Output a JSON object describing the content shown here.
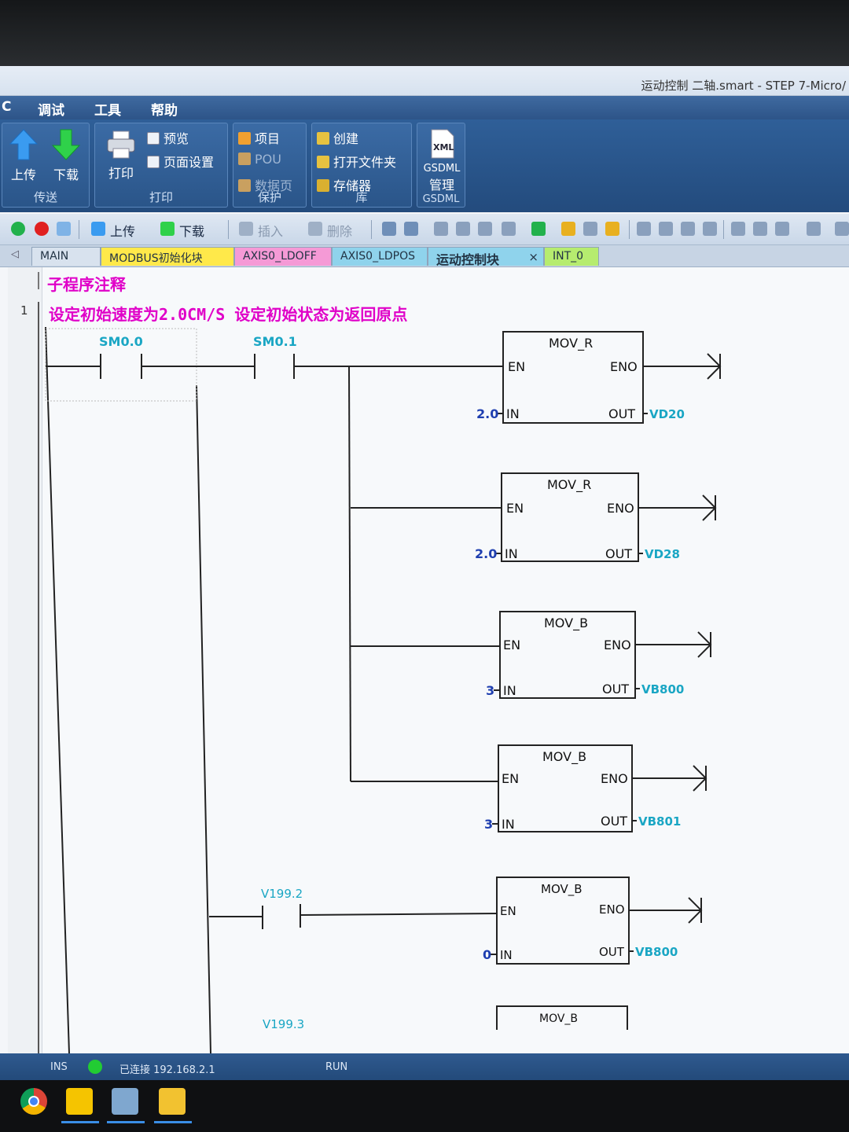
{
  "window": {
    "title": "运动控制 二轴.smart - STEP 7-Micro/"
  },
  "menu": {
    "items": [
      "C",
      "调试",
      "工具",
      "帮助"
    ]
  },
  "ribbon": {
    "transfer": {
      "upload": "上传",
      "download": "下载",
      "group": "传送"
    },
    "print": {
      "print": "打印",
      "preview": "预览",
      "page_setup": "页面设置",
      "group": "打印"
    },
    "protect": {
      "project": "项目",
      "pou": "POU",
      "data_page": "数据页",
      "group": "保护"
    },
    "library": {
      "create": "创建",
      "open_folder": "打开文件夹",
      "memory": "存储器",
      "group": "库"
    },
    "gsdml": {
      "xml": "XML",
      "label_1": "GSDML",
      "label_2": "管理",
      "group": "GSDML"
    }
  },
  "toolbar": {
    "upload": "上传",
    "download": "下载",
    "insert": "插入",
    "delete": "删除"
  },
  "tabs": [
    {
      "label": "MAIN",
      "color": "#d8e2ee"
    },
    {
      "label": "MODBUS初始化块",
      "color": "#ffe94a"
    },
    {
      "label": "AXIS0_LDOFF",
      "color": "#f59ad6"
    },
    {
      "label": "AXIS0_LDPOS",
      "color": "#8fd3ec"
    },
    {
      "label": "运动控制块",
      "color": "#8fd3ec"
    },
    {
      "label": "INT_0",
      "color": "#b6ec6f"
    }
  ],
  "tab_close": "×",
  "editor": {
    "subroutine_comment": "子程序注释",
    "network_number": "1",
    "network_comment": "设定初始速度为2.0CM/S 设定初始状态为返回原点"
  },
  "ladder": {
    "contacts": [
      "SM0.0",
      "SM0.1",
      "V199.2",
      "V199.3"
    ],
    "boxes": [
      {
        "title": "MOV_R",
        "en": "EN",
        "eno": "ENO",
        "in": "IN",
        "out": "OUT",
        "in_val": "2.0",
        "out_val": "VD20"
      },
      {
        "title": "MOV_R",
        "en": "EN",
        "eno": "ENO",
        "in": "IN",
        "out": "OUT",
        "in_val": "2.0",
        "out_val": "VD28"
      },
      {
        "title": "MOV_B",
        "en": "EN",
        "eno": "ENO",
        "in": "IN",
        "out": "OUT",
        "in_val": "3",
        "out_val": "VB800"
      },
      {
        "title": "MOV_B",
        "en": "EN",
        "eno": "ENO",
        "in": "IN",
        "out": "OUT",
        "in_val": "3",
        "out_val": "VB801"
      },
      {
        "title": "MOV_B",
        "en": "EN",
        "eno": "ENO",
        "in": "IN",
        "out": "OUT",
        "in_val": "0",
        "out_val": "VB800"
      },
      {
        "title": "MOV_B"
      }
    ]
  },
  "status": {
    "mode": "INS",
    "connection": "已连接 192.168.2.1",
    "run": "RUN",
    "led_color": "#22cc33"
  }
}
